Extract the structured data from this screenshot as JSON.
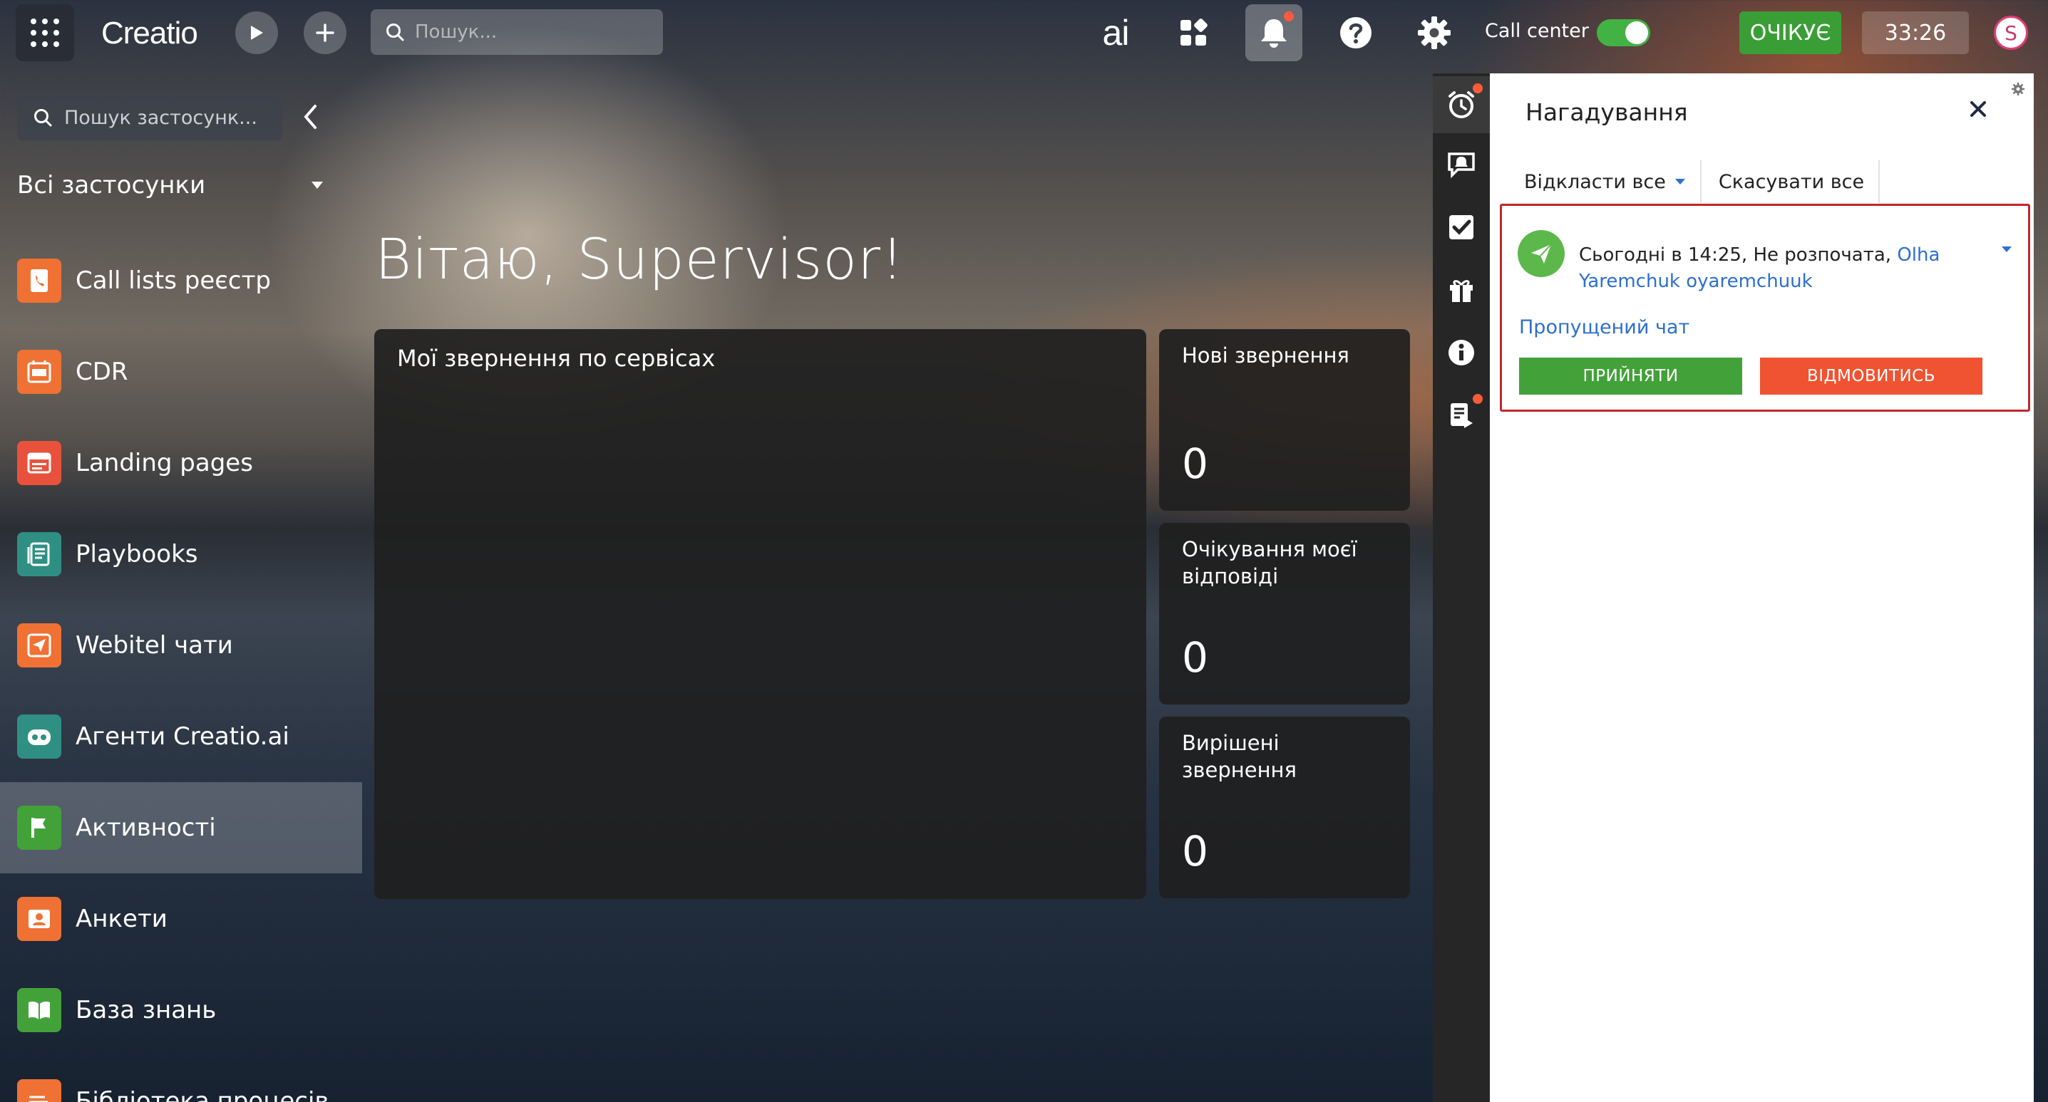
{
  "topbar": {
    "logo": "Creatio",
    "search_placeholder": "Пошук...",
    "ai_label": "ai",
    "call_center_label": "Call center",
    "call_center_on": true,
    "status_label": "ОЧІКУЄ",
    "timer": "33:26",
    "avatar_letter": "S",
    "accent_green": "#3a9e36"
  },
  "sidebar": {
    "search_placeholder": "Пошук застосунк...",
    "section_title": "Всі застосунки",
    "items": [
      {
        "label": "Call lists реєстр",
        "icon": "phone-book-icon",
        "color": "#ef7134"
      },
      {
        "label": "CDR",
        "icon": "cdr-icon",
        "color": "#ef7134"
      },
      {
        "label": "Landing pages",
        "icon": "landing-page-icon",
        "color": "#e8523c"
      },
      {
        "label": "Playbooks",
        "icon": "playbook-icon",
        "color": "#2f8f83"
      },
      {
        "label": "Webitel чати",
        "icon": "send-icon",
        "color": "#ef7134"
      },
      {
        "label": "Агенти Creatio.ai",
        "icon": "robot-icon",
        "color": "#2f8f83"
      },
      {
        "label": "Активності",
        "icon": "flag-icon",
        "color": "#43a13a",
        "active": true
      },
      {
        "label": "Анкети",
        "icon": "contact-card-icon",
        "color": "#ef7134"
      },
      {
        "label": "База знань",
        "icon": "book-icon",
        "color": "#43a13a"
      },
      {
        "label": "Бібліотека процесів",
        "icon": "process-library-icon",
        "color": "#ef7134"
      }
    ]
  },
  "main": {
    "greeting": "Вітаю, Supervisor!",
    "big_card_title": "Мої звернення по сервісах",
    "stats": [
      {
        "title": "Нові звернення",
        "value": "0"
      },
      {
        "title": "Очікування моєї відповіді",
        "value": "0"
      },
      {
        "title": "Вирішені звернення",
        "value": "0"
      }
    ]
  },
  "reminders": {
    "title": "Нагадування",
    "postpone_all": "Відкласти все",
    "cancel_all": "Скасувати все",
    "card": {
      "time": "Сьогодні в 14:25,",
      "status": "Не розпочата,",
      "link_name": "Olha Yaremchuk oyaremchuuk",
      "missed": "Пропущений чат",
      "accept": "ПРИЙНЯТИ",
      "decline": "ВІДМОВИТИСЬ"
    }
  }
}
